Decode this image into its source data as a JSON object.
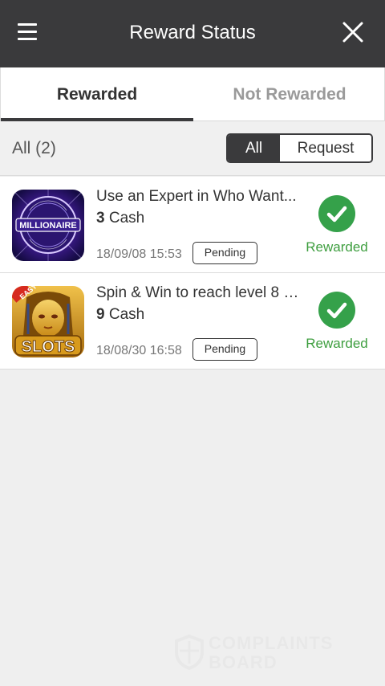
{
  "header": {
    "title": "Reward Status",
    "menu_icon": "hamburger-menu-icon",
    "close_icon": "close-icon"
  },
  "tabs": [
    {
      "label": "Rewarded",
      "active": true
    },
    {
      "label": "Not Rewarded",
      "active": false
    }
  ],
  "filter": {
    "count_label": "All (2)",
    "options": [
      {
        "label": "All",
        "selected": true
      },
      {
        "label": "Request",
        "selected": false
      }
    ]
  },
  "items": [
    {
      "icon": "millionaire-app-icon",
      "title": "Use an Expert in Who Want...",
      "cash_amount": "3",
      "cash_unit": "Cash",
      "date": "18/09/08 15:53",
      "badge": "Pending",
      "status": "Rewarded"
    },
    {
      "icon": "slots-app-icon",
      "title": "Spin & Win to reach level 8 -...",
      "cash_amount": "9",
      "cash_unit": "Cash",
      "date": "18/08/30 16:58",
      "badge": "Pending",
      "status": "Rewarded"
    }
  ],
  "watermark": {
    "line1": "COMPLAINTS",
    "line2": "BOARD"
  },
  "colors": {
    "header_bg": "#3a3a3c",
    "success_green": "#35a14a",
    "status_text_green": "#3e9e3f",
    "inactive_tab": "#9a9a9a",
    "page_bg": "#efefef"
  }
}
